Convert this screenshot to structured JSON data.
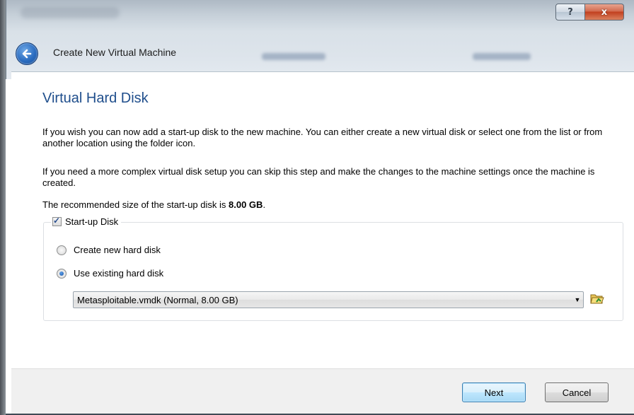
{
  "window": {
    "title": "Create New Virtual Machine",
    "help_glyph": "?",
    "close_glyph": "x"
  },
  "page": {
    "heading": "Virtual Hard Disk",
    "para1": "If you wish you can now add a start-up disk to the new machine. You can either create a new virtual disk or select one from the list or from another location using the folder icon.",
    "para2": "If you need a more complex virtual disk setup you can skip this step and make the changes to the machine settings once the machine is created.",
    "rec_prefix": "The recommended size of the start-up disk is ",
    "rec_size": "8.00 GB",
    "rec_suffix": "."
  },
  "startup_disk": {
    "label": "Start-up Disk",
    "checked": true,
    "options": [
      {
        "label": "Create new hard disk",
        "selected": false
      },
      {
        "label": "Use existing hard disk",
        "selected": true
      }
    ],
    "selected_disk": "Metasploitable.vmdk (Normal, 8.00 GB)"
  },
  "buttons": {
    "next": "Next",
    "cancel": "Cancel"
  },
  "icons": {
    "back": "back-arrow-icon",
    "folder": "folder-open-icon",
    "dropdown": "chevron-down-icon",
    "help": "help-icon",
    "close": "close-icon"
  },
  "colors": {
    "heading": "#1f4e8c",
    "close_button": "#c2401f",
    "next_border": "#3c7fb1"
  }
}
